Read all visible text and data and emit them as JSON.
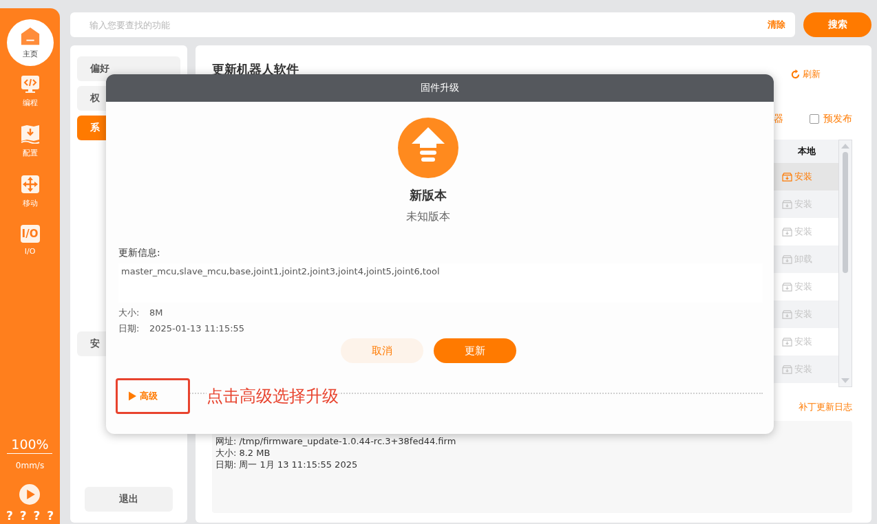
{
  "nav": {
    "items": [
      {
        "label": "主页",
        "kind": "home",
        "selected": true
      },
      {
        "label": "编程",
        "kind": "code",
        "selected": false
      },
      {
        "label": "配置",
        "kind": "config",
        "selected": false
      },
      {
        "label": "移动",
        "kind": "move",
        "selected": false
      },
      {
        "label": "I/O",
        "kind": "io",
        "badge": "I/O",
        "selected": false
      }
    ],
    "speed_ratio": "100%",
    "speed": "0mm/s",
    "status": "? ? ? ?"
  },
  "search": {
    "placeholder": "输入您要查找的功能",
    "clear": "清除",
    "button": "搜索"
  },
  "settings_menu": {
    "sections": [
      {
        "items": [
          {
            "label": "偏好",
            "selected": false
          },
          {
            "label": "权",
            "selected": false
          },
          {
            "label": "系",
            "selected": true
          }
        ]
      },
      {
        "items": [
          {
            "label": "安",
            "selected": false
          }
        ]
      }
    ],
    "logout": "退出"
  },
  "update_panel": {
    "title": "更新机器人软件",
    "refresh": "刷新",
    "partial_label": "器",
    "prerelease": {
      "label": "预发布",
      "checked": false
    },
    "table": {
      "columns": [
        "本地"
      ],
      "rows": [
        {
          "action": "安装",
          "disabled": false,
          "selected": true
        },
        {
          "action": "安装",
          "disabled": true,
          "selected": false
        },
        {
          "action": "安装",
          "disabled": true,
          "selected": false
        },
        {
          "action": "卸载",
          "disabled": true,
          "selected": false
        },
        {
          "action": "安装",
          "disabled": true,
          "selected": false
        },
        {
          "action": "安装",
          "disabled": true,
          "selected": false
        },
        {
          "action": "安装",
          "disabled": true,
          "selected": false
        },
        {
          "action": "安装",
          "disabled": true,
          "selected": false
        }
      ]
    },
    "patch_log": "补丁更新日志",
    "details": [
      {
        "label": "网址:",
        "value": "/tmp/firmware_update-1.0.44-rc.3+38fed44.firm"
      },
      {
        "label": "大小:",
        "value": "8.2 MB"
      },
      {
        "label": "日期:",
        "value": "周一 1月 13 11:15:55 2025"
      }
    ]
  },
  "dialog": {
    "title": "固件升级",
    "heading": "新版本",
    "version": "未知版本",
    "info_label": "更新信息:",
    "info": "master_mcu,slave_mcu,base,joint1,joint2,joint3,joint4,joint5,joint6,tool",
    "facts": [
      {
        "label": "大小:",
        "value": "8M"
      },
      {
        "label": "日期:",
        "value": "2025-01-13 11:15:55"
      }
    ],
    "buttons": [
      {
        "label": "取消",
        "kind": "secondary"
      },
      {
        "label": "更新",
        "kind": "primary"
      }
    ],
    "advanced": {
      "label": "高级",
      "expanded": false
    }
  },
  "annotation": "点击高级选择升级"
}
